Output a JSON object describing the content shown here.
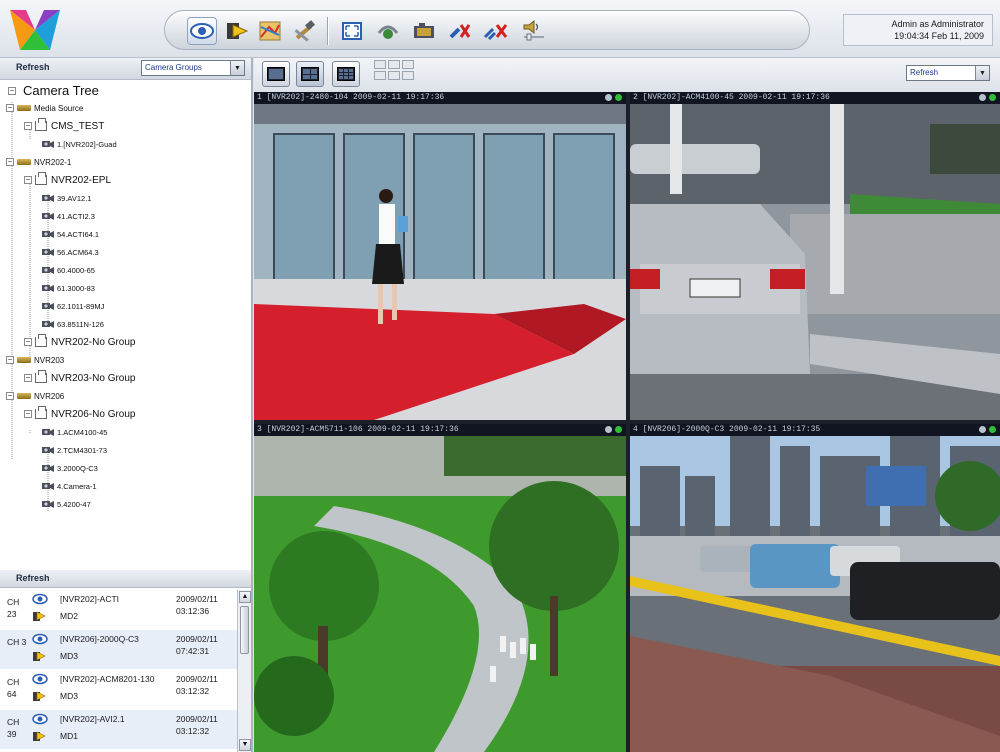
{
  "colors": {
    "accent": "#2b5fb4",
    "active_dot": "#2fbf3a",
    "idle_dot": "#b9c2cf",
    "carpet": "#d61f2c",
    "lawn": "#3f9a2e"
  },
  "header": {
    "user": "Admin as Administrator",
    "datetime": "19:04:34 Feb 11, 2009",
    "toolbar_icons": [
      "live-view-icon",
      "playback-icon",
      "map-icon",
      "tools-icon",
      "fullscreen-icon",
      "ptz-icon",
      "snapshot-icon",
      "disconnect-icon",
      "disconnect-all-icon",
      "volume-icon"
    ]
  },
  "left_panel": {
    "refresh_label": "Refresh",
    "group_select": "Camera Groups",
    "tree_title": "Camera Tree",
    "tree": [
      {
        "level": 0,
        "label": "Media Source",
        "icon": "nvr-icon"
      },
      {
        "level": 1,
        "label": "CMS_TEST",
        "icon": "group-icon"
      },
      {
        "level": 2,
        "label": "1.[NVR202]-Guad",
        "icon": "camera-icon"
      },
      {
        "level": 0,
        "label": "NVR202-1",
        "icon": "nvr-icon"
      },
      {
        "level": 1,
        "label": "NVR202-EPL",
        "icon": "group-icon"
      },
      {
        "level": 2,
        "label": "39.AV12.1",
        "icon": "camera-icon"
      },
      {
        "level": 2,
        "label": "41.ACTI2.3",
        "icon": "camera-icon"
      },
      {
        "level": 2,
        "label": "54.ACTI64.1",
        "icon": "camera-icon"
      },
      {
        "level": 2,
        "label": "56.ACM64.3",
        "icon": "camera-icon"
      },
      {
        "level": 2,
        "label": "60.4000-65",
        "icon": "camera-icon"
      },
      {
        "level": 2,
        "label": "61.3000-83",
        "icon": "camera-icon"
      },
      {
        "level": 2,
        "label": "62.1011-89MJ",
        "icon": "camera-icon"
      },
      {
        "level": 2,
        "label": "63.8511N-126",
        "icon": "camera-icon"
      },
      {
        "level": 1,
        "label": "NVR202-No Group",
        "icon": "group-icon"
      },
      {
        "level": 0,
        "label": "NVR203",
        "icon": "nvr-icon"
      },
      {
        "level": 1,
        "label": "NVR203-No Group",
        "icon": "group-icon"
      },
      {
        "level": 0,
        "label": "NVR206",
        "icon": "nvr-icon"
      },
      {
        "level": 1,
        "label": "NVR206-No Group",
        "icon": "group-icon"
      },
      {
        "level": 2,
        "label": "1.ACM4100-45",
        "icon": "camera-icon"
      },
      {
        "level": 2,
        "label": "2.TCM4301-73",
        "icon": "camera-icon"
      },
      {
        "level": 2,
        "label": "3.2000Q-C3",
        "icon": "camera-icon"
      },
      {
        "level": 2,
        "label": "4.Camera-1",
        "icon": "camera-icon"
      },
      {
        "level": 2,
        "label": "5.4200-47",
        "icon": "camera-icon"
      }
    ],
    "events_refresh_label": "Refresh",
    "events": [
      {
        "ch": "CH 23",
        "source": "[NVR202]-ACTI",
        "type": "MD2",
        "date": "2009/02/11",
        "time": "03:12:36"
      },
      {
        "ch": "CH 3",
        "source": "[NVR206]-2000Q-C3",
        "type": "MD3",
        "date": "2009/02/11",
        "time": "07:42:31"
      },
      {
        "ch": "CH 64",
        "source": "[NVR202]-ACM8201-130",
        "type": "MD3",
        "date": "2009/02/11",
        "time": "03:12:32"
      },
      {
        "ch": "CH 39",
        "source": "[NVR202]-AVI2.1",
        "type": "MD1",
        "date": "2009/02/11",
        "time": "03:12:32"
      }
    ]
  },
  "view_area": {
    "refresh_select": "Refresh",
    "layouts": [
      "1x1",
      "2x2",
      "3x3"
    ],
    "active_layout": "2x2",
    "views": [
      {
        "title": "1 [NVR202]-2480-104  2009-02-11 19:17:36",
        "status": "active"
      },
      {
        "title": "2 [NVR202]-ACM4100-45  2009-02-11 19:17:36",
        "status": "active"
      },
      {
        "title": "3 [NVR202]-ACM5711-106  2009-02-11 19:17:36",
        "status": "active"
      },
      {
        "title": "4 [NVR206]-2000Q-C3  2009-02-11 19:17:35",
        "status": "active"
      }
    ]
  }
}
